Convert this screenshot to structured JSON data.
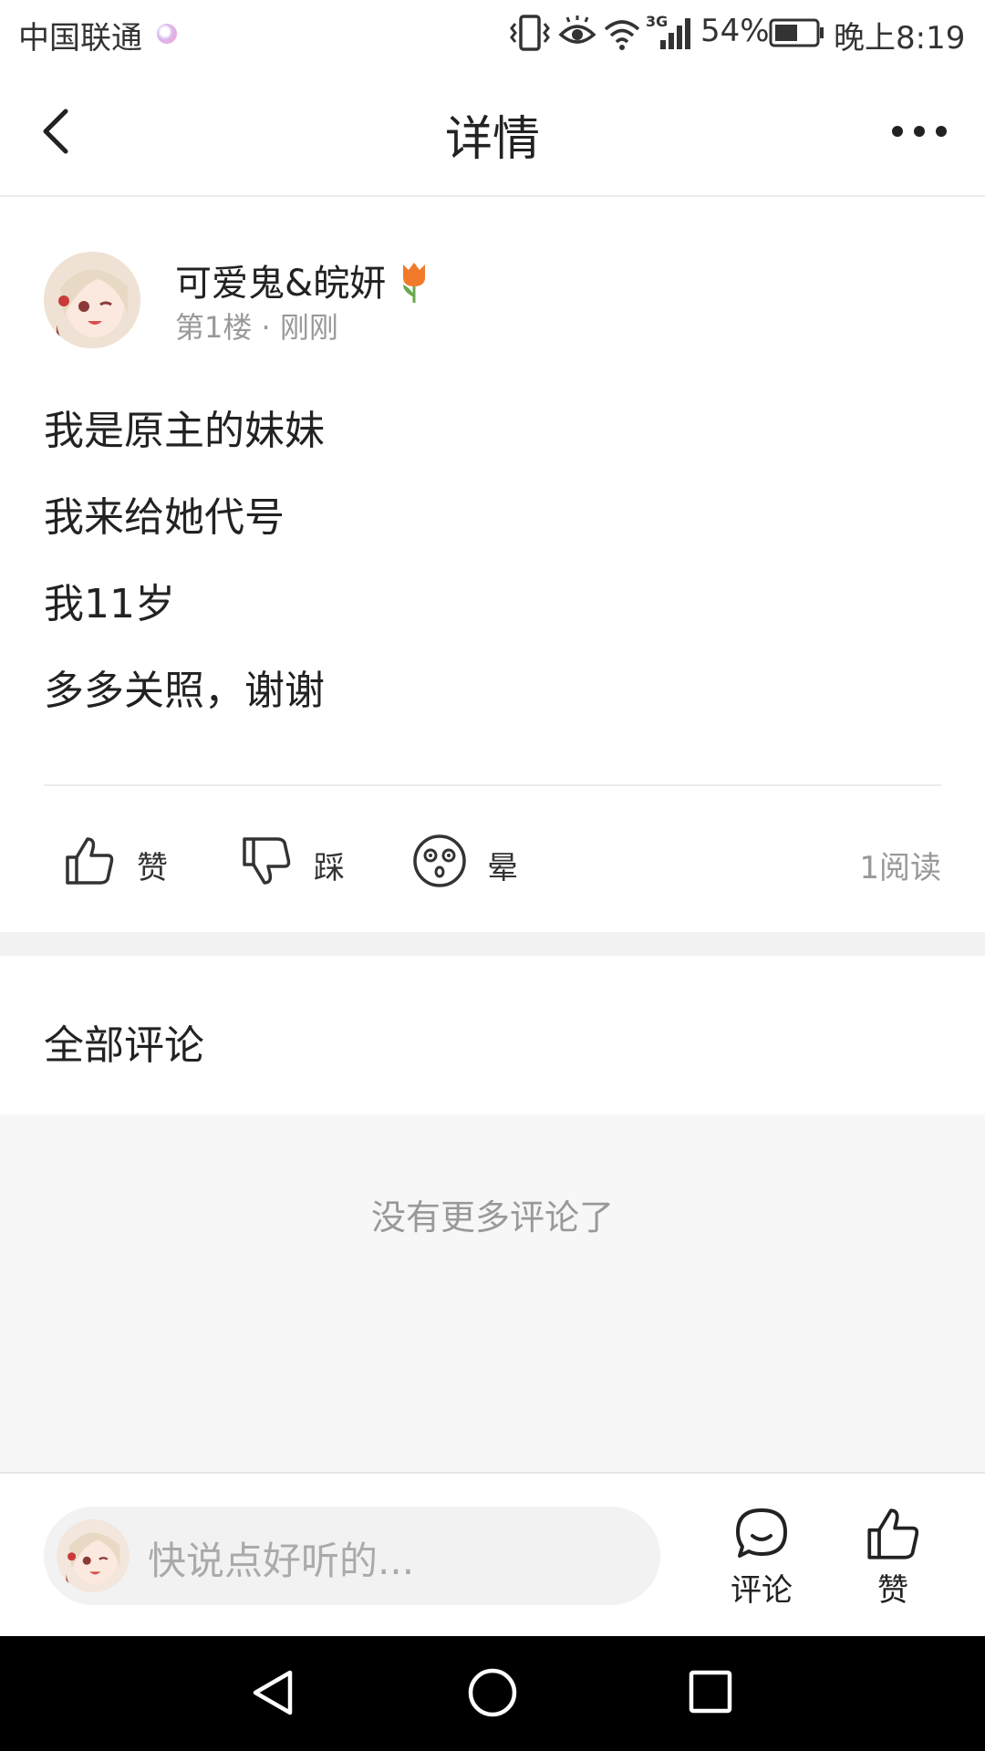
{
  "status_bar": {
    "carrier": "中国联通",
    "battery_percent": "54%",
    "time": "晚上8:19",
    "network": "3G"
  },
  "header": {
    "title": "详情"
  },
  "post": {
    "author": "可爱鬼&皖妍",
    "floor_meta": "第1楼 · 刚刚",
    "lines": [
      "我是原主的妹妹",
      "我来给她代号",
      "我11岁",
      "多多关照，谢谢"
    ],
    "reactions": {
      "like_label": "赞",
      "dislike_label": "踩",
      "dizzy_label": "晕"
    },
    "read_count": "1阅读"
  },
  "comments": {
    "heading": "全部评论",
    "empty_text": "没有更多评论了"
  },
  "bottom_bar": {
    "input_placeholder": "快说点好听的...",
    "comment_label": "评论",
    "like_label": "赞"
  },
  "colors": {
    "divider": "#ececec",
    "muted_text": "#999999",
    "band": "#f2f2f2"
  }
}
